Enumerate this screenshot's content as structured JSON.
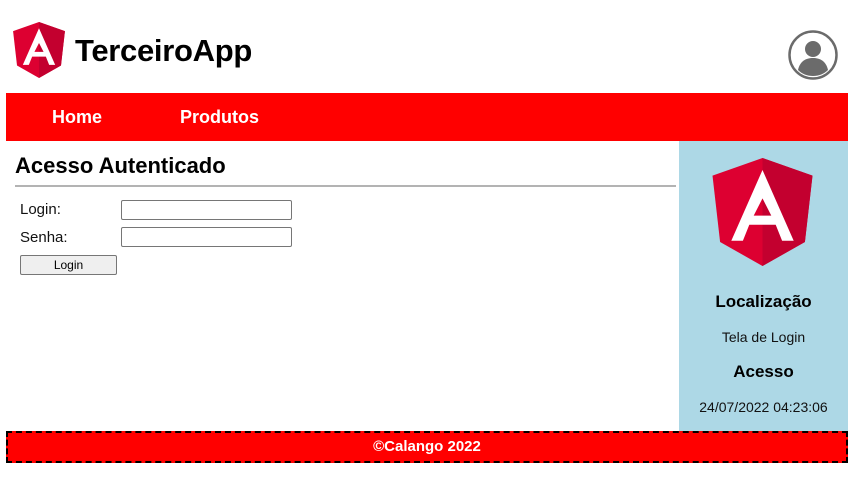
{
  "header": {
    "app_title": "TerceiroApp",
    "logo_icon": "angular-logo-icon",
    "avatar_icon": "user-avatar-icon"
  },
  "nav": {
    "items": [
      {
        "label": "Home"
      },
      {
        "label": "Produtos"
      }
    ]
  },
  "main": {
    "title": "Acesso Autenticado",
    "form": {
      "login_label": "Login:",
      "login_value": "",
      "senha_label": "Senha:",
      "senha_value": "",
      "submit_label": "Login"
    }
  },
  "sidebar": {
    "logo_icon": "angular-logo-icon",
    "location_title": "Localização",
    "location_value": "Tela de Login",
    "access_title": "Acesso",
    "access_value": "24/07/2022 04:23:06"
  },
  "footer": {
    "text": "©Calango 2022"
  },
  "colors": {
    "nav_bg": "#ff0000",
    "footer_bg": "#ff0000",
    "sidebar_bg": "#add8e6",
    "angular_red": "#dd0031",
    "angular_dark_red": "#c3002f"
  }
}
